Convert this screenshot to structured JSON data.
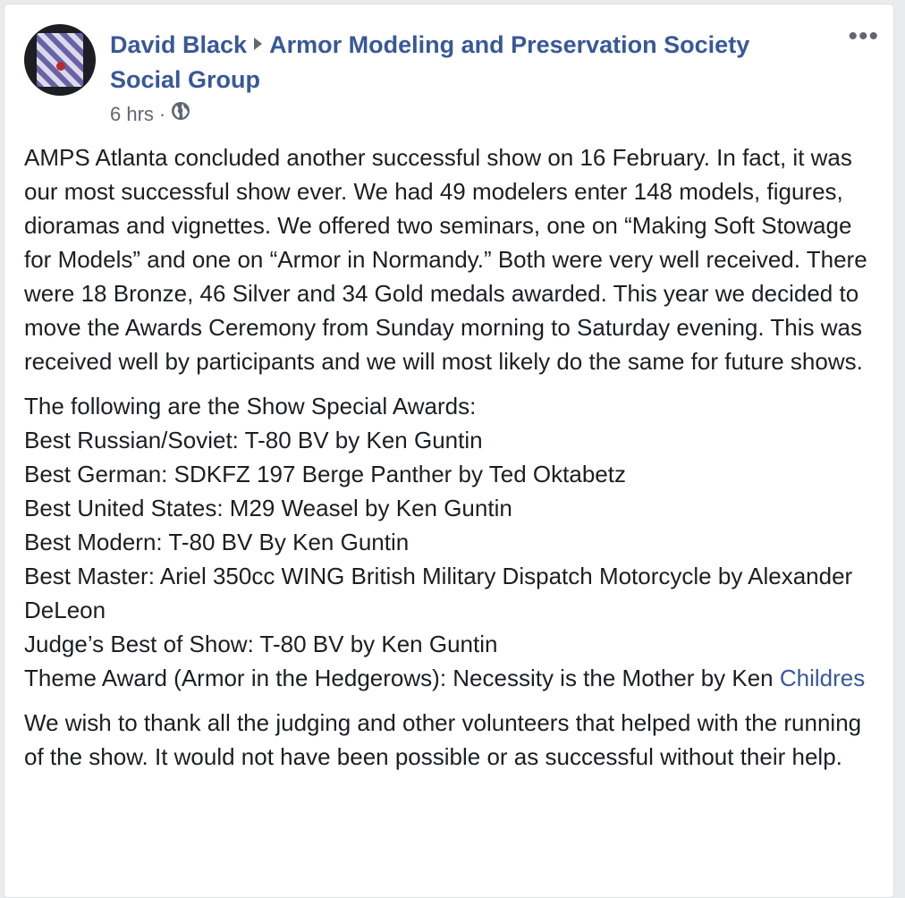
{
  "post": {
    "author": "David Black",
    "group": "Armor Modeling and Preservation Society Social Group",
    "time": "6 hrs",
    "separator": "·",
    "privacy_icon": "globe-icon",
    "more_icon": "more-options-icon",
    "more_label": "•••",
    "paragraph1": "AMPS Atlanta concluded another successful show on 16 February. In fact, it was our most successful show ever. We had 49 modelers enter 148 models, figures, dioramas and vignettes. We offered two seminars, one on “Making Soft Stowage for Models” and one on “Armor in Normandy.” Both were very well received. There were 18 Bronze, 46 Silver and 34 Gold medals awarded. This year we decided to move the Awards Ceremony from Sunday morning to Saturday evening. This was received well by participants and we will most likely do the same for future shows.",
    "awards_intro": "The following are the Show Special Awards:",
    "awards": [
      "Best Russian/Soviet: T-80 BV by Ken Guntin",
      "Best German: SDKFZ 197 Berge Panther by Ted Oktabetz",
      "Best United States: M29 Weasel by Ken Guntin",
      "Best Modern: T-80 BV By Ken Guntin",
      "Best Master: Ariel 350cc WING British Military Dispatch Motorcycle by Alexander DeLeon",
      "Judge’s Best of Show: T-80 BV by Ken Guntin"
    ],
    "theme_award": "Theme Award (Armor in the Hedgerows): Necessity is the Mother by Ken",
    "theme_award_link": "Childres",
    "paragraph3": "We wish to thank all the judging and other volunteers that helped with the running of the show. It would not have been possible or as successful without their help."
  },
  "colors": {
    "link": "#385898",
    "text": "#1c1e21",
    "meta": "#606770"
  }
}
